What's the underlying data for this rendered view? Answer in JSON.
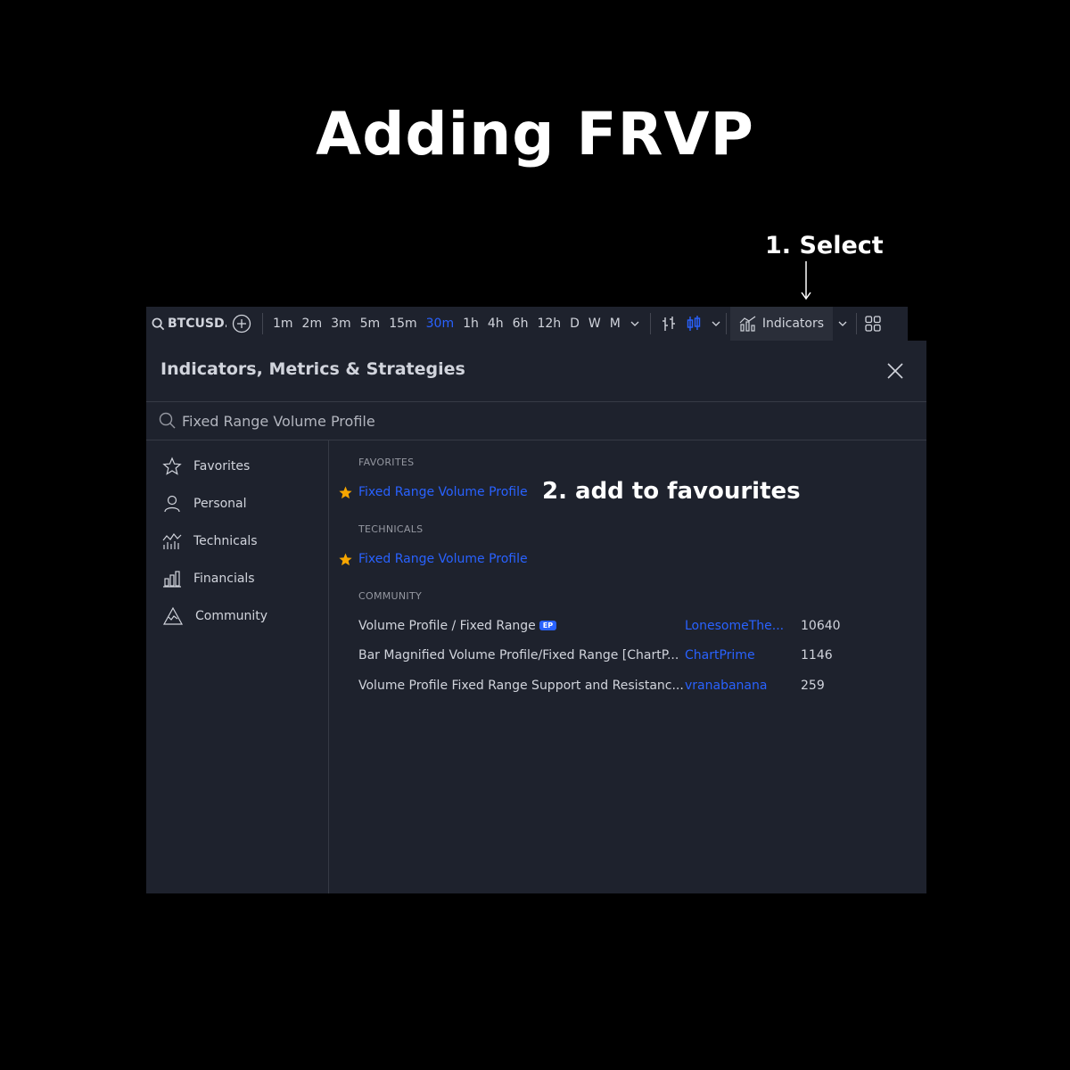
{
  "headline": "Adding FRVP",
  "annotations": {
    "step1": "1. Select",
    "step2": "2. add to favourites"
  },
  "toolbar": {
    "symbol": "BTCUSD.P",
    "timeframes": [
      "1m",
      "2m",
      "3m",
      "5m",
      "15m",
      "30m",
      "1h",
      "4h",
      "6h",
      "12h",
      "D",
      "W",
      "M"
    ],
    "active_timeframe": "30m",
    "indicators_label": "Indicators"
  },
  "dialog": {
    "title": "Indicators, Metrics & Strategies",
    "search_value": "Fixed Range Volume Profile",
    "sidebar": [
      {
        "label": "Favorites",
        "icon": "star-outline-icon"
      },
      {
        "label": "Personal",
        "icon": "user-icon"
      },
      {
        "label": "Technicals",
        "icon": "chart-line-icon"
      },
      {
        "label": "Financials",
        "icon": "bar-chart-icon"
      },
      {
        "label": "Community",
        "icon": "mountain-icon"
      }
    ],
    "favorites": {
      "label": "FAVORITES",
      "item": "Fixed Range Volume Profile"
    },
    "technicals": {
      "label": "TECHNICALS",
      "item": "Fixed Range Volume Profile"
    },
    "community": {
      "label": "COMMUNITY",
      "items": [
        {
          "name": "Volume Profile / Fixed Range",
          "badge": "EP",
          "author": "LonesomeThe...",
          "count": "10640"
        },
        {
          "name": "Bar Magnified Volume Profile/Fixed Range [ChartP...",
          "badge": "",
          "author": "ChartPrime",
          "count": "1146"
        },
        {
          "name": "Volume Profile Fixed Range Support and Resistanc...",
          "badge": "",
          "author": "vranabanana",
          "count": "259"
        }
      ]
    }
  },
  "colors": {
    "accent": "#2962ff",
    "star": "#f7a600",
    "panel": "#1e222d",
    "background": "#000000"
  }
}
